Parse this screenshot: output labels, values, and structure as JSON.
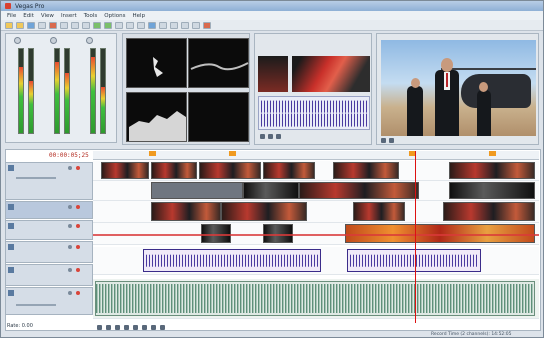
{
  "window": {
    "title": "Vegas Pro"
  },
  "menubar": {
    "items": [
      "File",
      "Edit",
      "View",
      "Insert",
      "Tools",
      "Options",
      "Help"
    ]
  },
  "timeline": {
    "timecode": "00:00:05;25",
    "rate_label": "Rate: 0.00"
  },
  "status": {
    "text": "Record Time (2 channels): 14:52:05"
  },
  "meters": {
    "levels": [
      0.78,
      0.62,
      0.85,
      0.71,
      0.9,
      0.55
    ]
  },
  "colors": {
    "accent": "#d93a3a",
    "cursor": "#dd1111",
    "marker": "#f09a20"
  }
}
